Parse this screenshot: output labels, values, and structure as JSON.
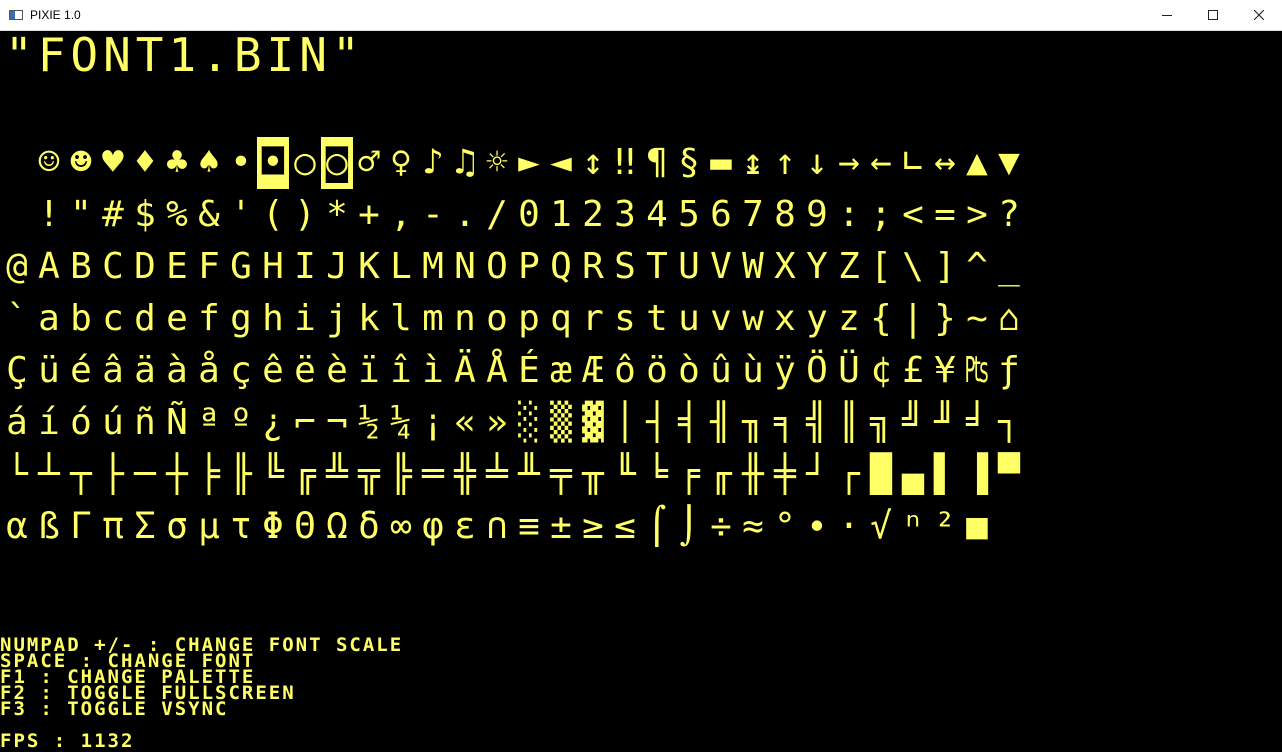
{
  "window": {
    "title": "PIXIE 1.0",
    "controls": [
      "minimize",
      "maximize",
      "close"
    ]
  },
  "screen": {
    "font_name": "\"FONT1.BIN\"",
    "glyph_color": "#ffff66",
    "background_color": "#000000",
    "glyph_rows": [
      [
        " ",
        "☺",
        "☻",
        "♥",
        "♦",
        "♣",
        "♠",
        "•",
        "◘",
        "○",
        "◙",
        "♂",
        "♀",
        "♪",
        "♫",
        "☼",
        "►",
        "◄",
        "↕",
        "‼",
        "¶",
        "§",
        "▬",
        "↨",
        "↑",
        "↓",
        "→",
        "←",
        "∟",
        "↔",
        "▲",
        "▼"
      ],
      [
        " ",
        "!",
        "\"",
        "#",
        "$",
        "%",
        "&",
        "'",
        "(",
        ")",
        "*",
        "+",
        ",",
        "-",
        ".",
        "/",
        "0",
        "1",
        "2",
        "3",
        "4",
        "5",
        "6",
        "7",
        "8",
        "9",
        ":",
        ";",
        "<",
        "=",
        ">",
        "?"
      ],
      [
        "@",
        "A",
        "B",
        "C",
        "D",
        "E",
        "F",
        "G",
        "H",
        "I",
        "J",
        "K",
        "L",
        "M",
        "N",
        "O",
        "P",
        "Q",
        "R",
        "S",
        "T",
        "U",
        "V",
        "W",
        "X",
        "Y",
        "Z",
        "[",
        "\\",
        "]",
        "^",
        "_"
      ],
      [
        "`",
        "a",
        "b",
        "c",
        "d",
        "e",
        "f",
        "g",
        "h",
        "i",
        "j",
        "k",
        "l",
        "m",
        "n",
        "o",
        "p",
        "q",
        "r",
        "s",
        "t",
        "u",
        "v",
        "w",
        "x",
        "y",
        "z",
        "{",
        "|",
        "}",
        "~",
        "⌂"
      ],
      [
        "Ç",
        "ü",
        "é",
        "â",
        "ä",
        "à",
        "å",
        "ç",
        "ê",
        "ë",
        "è",
        "ï",
        "î",
        "ì",
        "Ä",
        "Å",
        "É",
        "æ",
        "Æ",
        "ô",
        "ö",
        "ò",
        "û",
        "ù",
        "ÿ",
        "Ö",
        "Ü",
        "¢",
        "£",
        "¥",
        "₧",
        "ƒ"
      ],
      [
        "á",
        "í",
        "ó",
        "ú",
        "ñ",
        "Ñ",
        "ª",
        "º",
        "¿",
        "⌐",
        "¬",
        "½",
        "¼",
        "¡",
        "«",
        "»",
        "░",
        "▒",
        "▓",
        "│",
        "┤",
        "╡",
        "╢",
        "╖",
        "╕",
        "╣",
        "║",
        "╗",
        "╝",
        "╜",
        "╛",
        "┐"
      ],
      [
        "└",
        "┴",
        "┬",
        "├",
        "─",
        "┼",
        "╞",
        "╟",
        "╚",
        "╔",
        "╩",
        "╦",
        "╠",
        "═",
        "╬",
        "╧",
        "╨",
        "╤",
        "╥",
        "╙",
        "╘",
        "╒",
        "╓",
        "╫",
        "╪",
        "┘",
        "┌",
        "█",
        "▄",
        "▌",
        "▐",
        "▀"
      ],
      [
        "α",
        "ß",
        "Γ",
        "π",
        "Σ",
        "σ",
        "µ",
        "τ",
        "Φ",
        "Θ",
        "Ω",
        "δ",
        "∞",
        "φ",
        "ε",
        "∩",
        "≡",
        "±",
        "≥",
        "≤",
        "⌠",
        "⌡",
        "÷",
        "≈",
        "°",
        "∙",
        "·",
        "√",
        "ⁿ",
        "²",
        "■",
        " "
      ]
    ],
    "inverted_glyphs": [
      [
        0,
        8
      ],
      [
        0,
        10
      ]
    ],
    "help_lines": [
      "NUMPAD +/- : CHANGE FONT SCALE",
      "SPACE : CHANGE FONT",
      "F1 : CHANGE PALETTE",
      "F2 : TOGGLE FULLSCREEN",
      "F3 : TOGGLE VSYNC"
    ],
    "fps_text": "FPS : 1132"
  }
}
